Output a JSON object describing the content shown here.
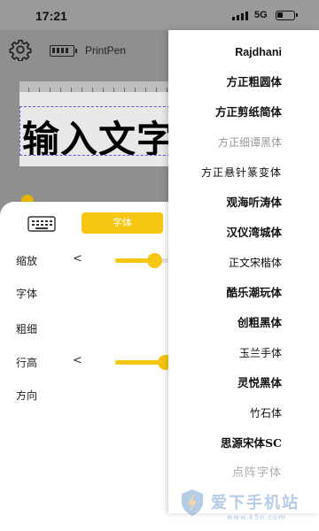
{
  "status": {
    "time": "17:21",
    "network": "5G"
  },
  "topbar": {
    "settings_icon": "gear-icon",
    "device_battery_icon": "battery-icon",
    "device_name": "PrintPen"
  },
  "canvas": {
    "text": "输入文字"
  },
  "panel": {
    "keyboard_icon": "keyboard-icon",
    "tab_font": "字体",
    "rows": {
      "zoom": "缩放",
      "font": "字体",
      "weight": "粗细",
      "line_height": "行高",
      "direction": "方向"
    },
    "chevron": "<",
    "zoom_level": 0.55,
    "line_height_level": 0.7
  },
  "font_menu": {
    "items": [
      "Rajdhani",
      "方正粗圆体",
      "方正剪纸简体",
      "方正细谭黑体",
      "方正悬针篆变体",
      "观海听涛体",
      "汉仪湾城体",
      "正文宋楷体",
      "酷乐潮玩体",
      "创粗黑体",
      "玉兰手体",
      "灵悦黑体",
      "竹石体",
      "思源宋体SC",
      "点阵字体"
    ]
  },
  "watermark": {
    "brand": "爱下手机站",
    "url": "www.k5n.com"
  },
  "colors": {
    "accent": "#f7c613",
    "panel_bg": "#ffffff",
    "overlay": "#8f8f8f"
  }
}
